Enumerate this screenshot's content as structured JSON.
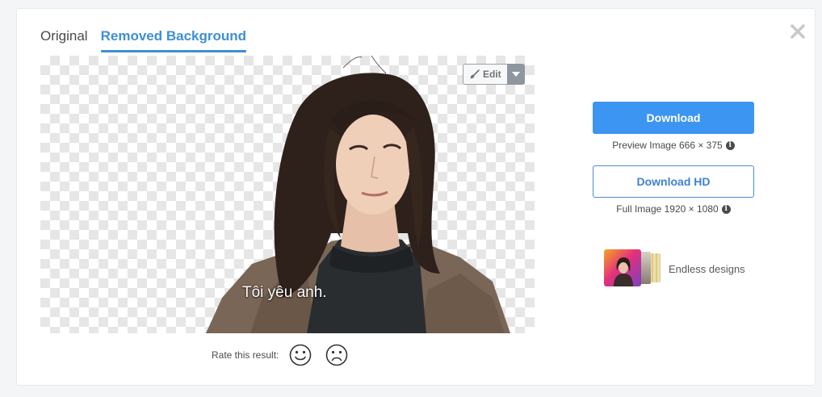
{
  "tabs": [
    {
      "label": "Original",
      "active": false
    },
    {
      "label": "Removed Background",
      "active": true
    }
  ],
  "preview": {
    "subtitle_text": "Tôi yêu anh.",
    "edit_label": "Edit"
  },
  "rating": {
    "label": "Rate this result:",
    "options": [
      "smile-icon",
      "frown-icon"
    ]
  },
  "download": {
    "label": "Download",
    "info": "Preview Image 666 × 375"
  },
  "download_hd": {
    "label": "Download HD",
    "info": "Full Image 1920 × 1080"
  },
  "promo": {
    "label": "Endless designs"
  },
  "colors": {
    "accent": "#3e8ed8",
    "primary_button": "#3d95f2",
    "outline_button": "#4b8cd0"
  }
}
